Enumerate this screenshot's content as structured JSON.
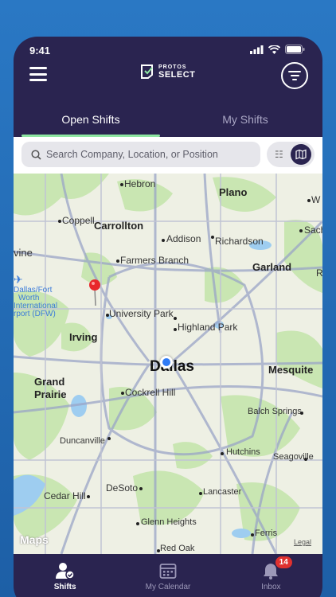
{
  "status_bar": {
    "time": "9:41"
  },
  "header": {
    "logo_top": "PROTOS",
    "logo_bottom": "SELECT"
  },
  "tabs": [
    {
      "label": "Open Shifts"
    },
    {
      "label": "My Shifts"
    }
  ],
  "search": {
    "placeholder": "Search Company, Location, or Position"
  },
  "map": {
    "labels": {
      "hebron": "Hebron",
      "plano": "Plano",
      "coppell": "Coppell",
      "carrollton": "Carrollton",
      "addison": "Addison",
      "richardson": "Richardson",
      "sachse": "Sach",
      "w": "W",
      "farmers_branch": "Farmers Branch",
      "garland": "Garland",
      "irvine": "vine",
      "university_park": "University Park",
      "highland_park": "Highland Park",
      "irving": "Irving",
      "dallas": "Dallas",
      "mesquite": "Mesquite",
      "grand": "Grand",
      "prairie": "Prairie",
      "cockrell_hill": "Cockrell Hill",
      "balch_springs": "Balch Springs",
      "duncanville": "Duncanville",
      "hutchins": "Hutchins",
      "seagoville": "Seagoville",
      "desoto": "DeSoto",
      "cedar_hill": "Cedar Hill",
      "lancaster": "Lancaster",
      "glenn_heights": "Glenn Heights",
      "ferris": "Ferris",
      "red_oak": "Red Oak",
      "airport_1": "Dallas/Fort",
      "airport_2": "Worth",
      "airport_3": "International",
      "airport_4": "rport (DFW)",
      "r": "R"
    },
    "attribution": "Maps",
    "legal": "Legal"
  },
  "bottom_nav": [
    {
      "label": "Shifts"
    },
    {
      "label": "My Calendar"
    },
    {
      "label": "Inbox",
      "badge": "14"
    }
  ]
}
